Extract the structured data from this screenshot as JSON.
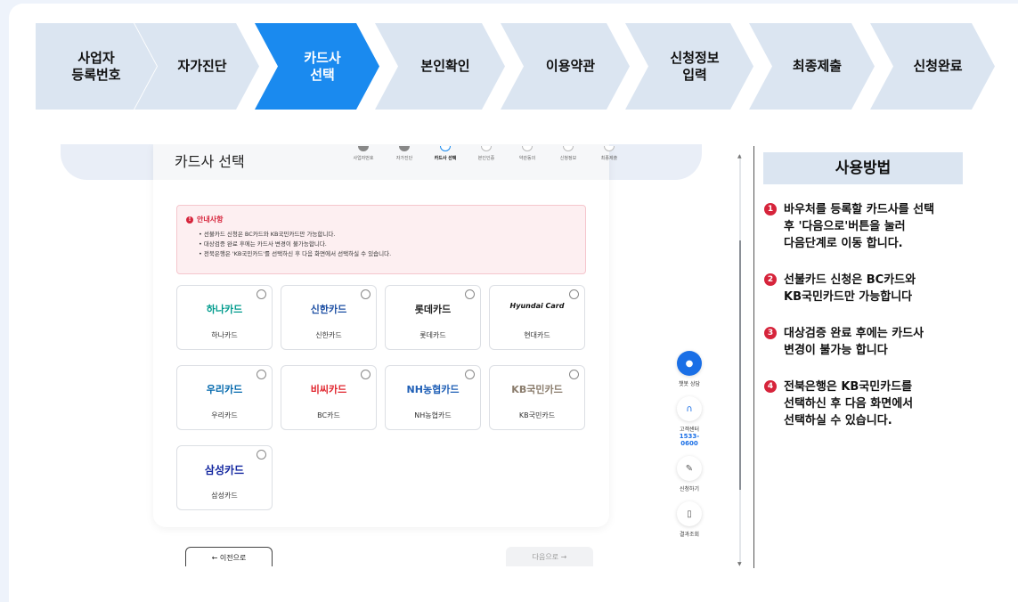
{
  "stepper": [
    {
      "label": "사업자\n등록번호",
      "active": false
    },
    {
      "label": "자가진단",
      "active": false
    },
    {
      "label": "카드사\n선택",
      "active": true
    },
    {
      "label": "본인확인",
      "active": false
    },
    {
      "label": "이용약관",
      "active": false
    },
    {
      "label": "신청정보\n입력",
      "active": false
    },
    {
      "label": "최종제출",
      "active": false
    },
    {
      "label": "신청완료",
      "active": false
    }
  ],
  "panel": {
    "title": "카드사 선택",
    "mini_steps": [
      {
        "num": "",
        "label": "사업자번호"
      },
      {
        "num": "",
        "label": "자가진단"
      },
      {
        "num": "3",
        "label": "카드사 선택"
      },
      {
        "num": "4",
        "label": "본인인증"
      },
      {
        "num": "5",
        "label": "약관동의"
      },
      {
        "num": "6",
        "label": "신청정보"
      },
      {
        "num": "7",
        "label": "최종제출"
      }
    ]
  },
  "notice": {
    "title": "안내사항",
    "lines": [
      "• 선불카드 신청은 BC카드와 KB국민카드만 가능합니다.",
      "• 대상검증 완료 후에는 카드사 변경이 불가능합니다.",
      "• 전북은행은 'KB국민카드'를 선택하신 후 다음 화면에서 선택하실 수 있습니다."
    ]
  },
  "cards": [
    {
      "logo": "하나카드",
      "name": "하나카드",
      "color": "#009b8d"
    },
    {
      "logo": "신한카드",
      "name": "신한카드",
      "color": "#1d4fa3"
    },
    {
      "logo": "롯데카드",
      "name": "롯데카드",
      "color": "#222222"
    },
    {
      "logo": "Hyundai Card",
      "name": "현대카드",
      "color": "#111111"
    },
    {
      "logo": "우리카드",
      "name": "우리카드",
      "color": "#0067ac"
    },
    {
      "logo": "비씨카드",
      "name": "BC카드",
      "color": "#e0242d"
    },
    {
      "logo": "NH농협카드",
      "name": "NH농협카드",
      "color": "#1f5fb6"
    },
    {
      "logo": "KB국민카드",
      "name": "KB국민카드",
      "color": "#8a7c6c"
    },
    {
      "logo": "삼성카드",
      "name": "삼성카드",
      "color": "#1428a0"
    }
  ],
  "buttons": {
    "prev": "← 이전으로",
    "next": "다음으로 →"
  },
  "float_menu": {
    "chat": "챗봇 상담",
    "center": "고객센터",
    "phone": "1533-0600",
    "apply": "신청하기",
    "result": "결과조회"
  },
  "howto": {
    "title": "사용방법",
    "items": [
      {
        "num": "1",
        "text": "바우처를 등록할 카드사를 선택\n후 '다음으로'버튼을 눌러\n다음단계로 이동 합니다."
      },
      {
        "num": "2",
        "text": "선불카드 신청은 BC카드와\nKB국민카드만 가능합니다"
      },
      {
        "num": "3",
        "text": "대상검증 완료 후에는 카드사\n변경이 불가능 합니다"
      },
      {
        "num": "4",
        "text": "전북은행은 KB국민카드를\n선택하신 후 다음 화면에서\n선택하실 수 있습니다."
      }
    ]
  },
  "colors": {
    "accent": "#1a8aef",
    "step_bg": "#dbe5f1",
    "alert": "#d6243b"
  }
}
